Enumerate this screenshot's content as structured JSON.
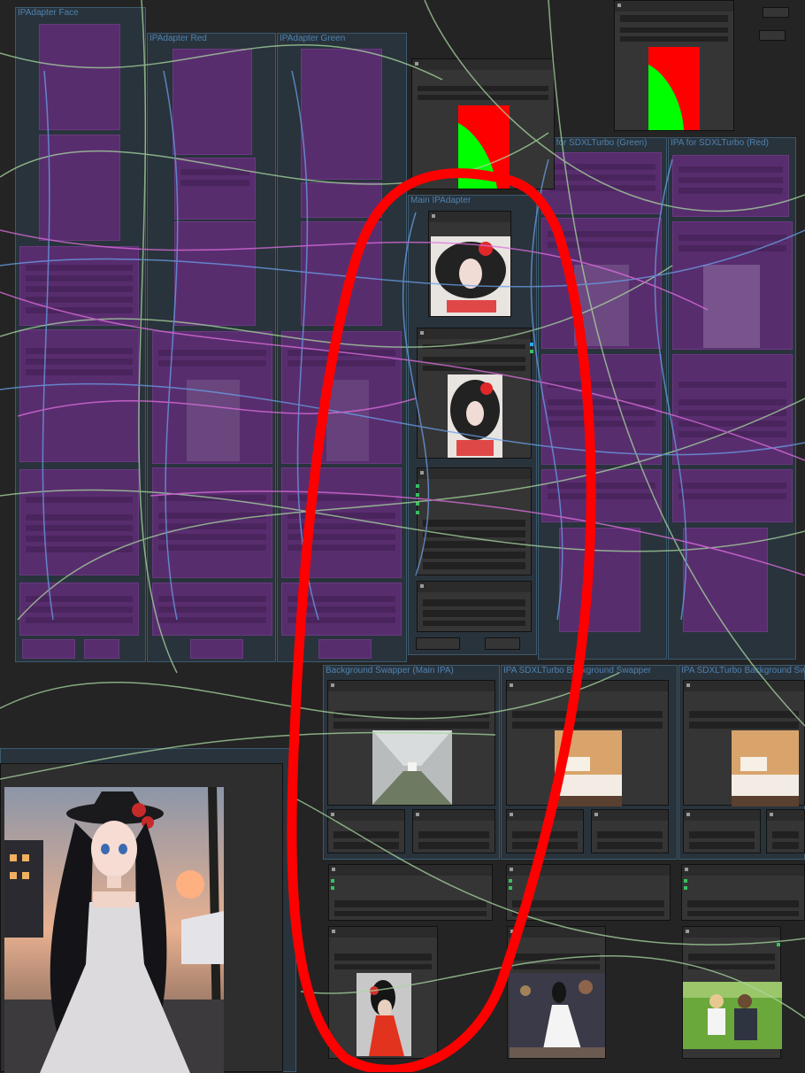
{
  "groups": {
    "ipadapter_face": "IPAdapter Face",
    "ipadapter_red": "IPAdapter Red",
    "ipadapter_green": "IPAdapter Green",
    "main_ipadapter": "Main IPAdapter",
    "ipa_sdxl_green": "IPA for SDXLTurbo (Green)",
    "ipa_sdxl_red": "IPA for SDXLTurbo (Red)",
    "bg_swapper_main": "Background Swapper (Main IPA)",
    "ipa_sdxl_bg_1": "IPA SDXLTurbo Background Swapper",
    "ipa_sdxl_bg_2": "IPA SDXLTurbo Background Swapper"
  },
  "images": {
    "mask_preview_top": "green/red mask preview",
    "mask_preview_small": "green/red mask preview",
    "portrait_ink_1": "ink portrait of woman with red flower",
    "portrait_ink_2": "ink portrait of woman with red flower",
    "corridor": "abandoned industrial corridor",
    "bathroom_1": "bathroom interior",
    "bathroom_2": "bathroom interior",
    "woman_red_dress": "woman in red dress",
    "woman_white_dress": "woman in white dress",
    "couple_field": "couple in green field",
    "anime_girl": "anime girl in white dress and black hat at sunset"
  },
  "colors": {
    "background": "#242424",
    "group_fill": "#29333c",
    "group_border": "#3c5a6e",
    "group_title": "#4f82b0",
    "node": "#353535",
    "bypassed_node": "#5c2d72",
    "annotation_stroke": "#ff0000",
    "wire_green": "#a8d8a0",
    "wire_blue": "#6aa0e8",
    "wire_pink": "#e070e0",
    "mask_green": "#00ff00",
    "mask_red": "#ff0000"
  }
}
